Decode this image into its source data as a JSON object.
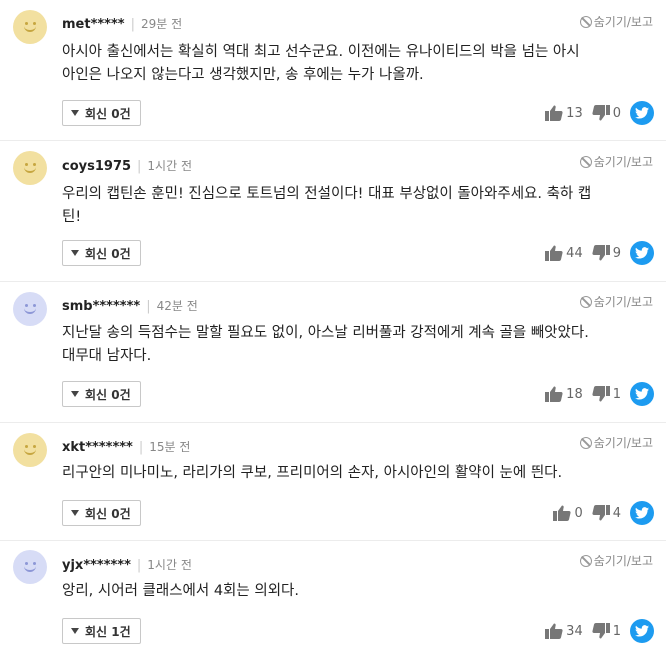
{
  "hide_label": "숨기기/보고",
  "comments": [
    {
      "author": "met*****",
      "time": "29분 전",
      "avatar": "yellow",
      "lines": [
        "아시아 출신에서는 확실히 역대 최고 선수군요. 이전에는 유나이티드의 박을 넘는 아시",
        "아인은 나오지 않는다고 생각했지만, 송 후에는 누가 나올까."
      ],
      "reply": "회신 0건",
      "likes": "13",
      "dislikes": "0"
    },
    {
      "author": "coys1975",
      "time": "1시간 전",
      "avatar": "yellow",
      "lines": [
        "우리의 캡틴손 훈민! 진심으로 토트넘의 전설이다! 대표 부상없이 돌아와주세요. 축하 캡",
        "틴!"
      ],
      "reply": "회신 0건",
      "likes": "44",
      "dislikes": "9"
    },
    {
      "author": "smb*******",
      "time": "42분 전",
      "avatar": "blue",
      "lines": [
        "지난달 송의 득점수는 말할 필요도 없이, 아스날 리버풀과 강적에게 계속 골을 빼앗았다.",
        "대무대 남자다."
      ],
      "reply": "회신 0건",
      "likes": "18",
      "dislikes": "1"
    },
    {
      "author": "xkt*******",
      "time": "15분 전",
      "avatar": "yellow",
      "lines": [
        "리구안의 미나미노, 라리가의 쿠보, 프리미어의 손자, 아시아인의 활약이 눈에 띈다."
      ],
      "reply": "회신 0건",
      "likes": "0",
      "dislikes": "4"
    },
    {
      "author": "yjx*******",
      "time": "1시간 전",
      "avatar": "blue",
      "lines": [
        "앙리, 시어러 클래스에서 4회는 의외다."
      ],
      "reply": "회신 1건",
      "likes": "34",
      "dislikes": "1"
    }
  ]
}
